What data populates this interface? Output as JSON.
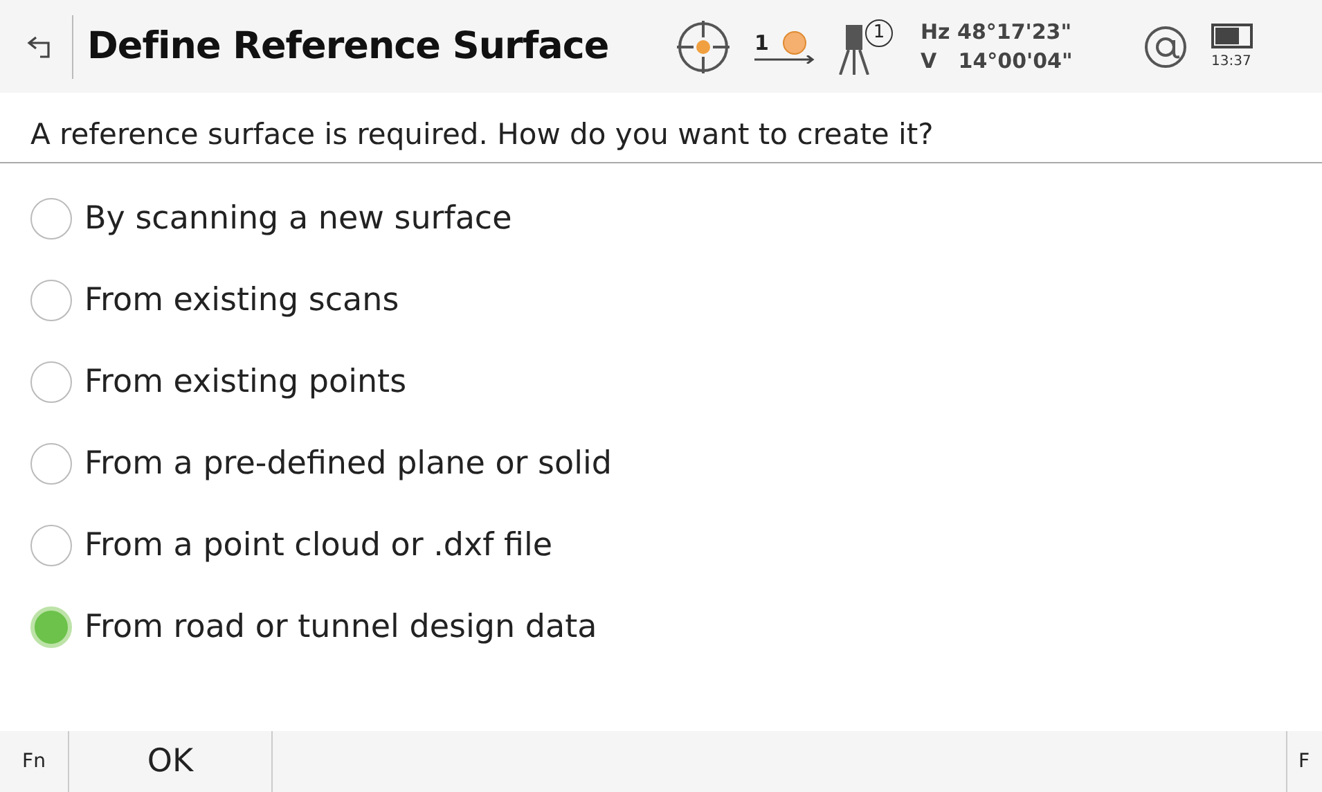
{
  "header": {
    "title": "Define Reference Surface",
    "prism_number": "1",
    "instrument_number": "1",
    "hz": "Hz 48°17'23\"",
    "v": "V   14°00'04\"",
    "time": "13:37"
  },
  "question": "A reference surface is required. How do you want to create it?",
  "options": [
    {
      "label": "By scanning a new surface",
      "selected": false
    },
    {
      "label": "From existing scans",
      "selected": false
    },
    {
      "label": "From existing points",
      "selected": false
    },
    {
      "label": "From a pre-defined plane or solid",
      "selected": false
    },
    {
      "label": "From a point cloud or .dxf file",
      "selected": false
    },
    {
      "label": "From road or tunnel design data",
      "selected": true
    }
  ],
  "footer": {
    "left_fn": "Fn",
    "ok": "OK",
    "right_fn": "F"
  }
}
